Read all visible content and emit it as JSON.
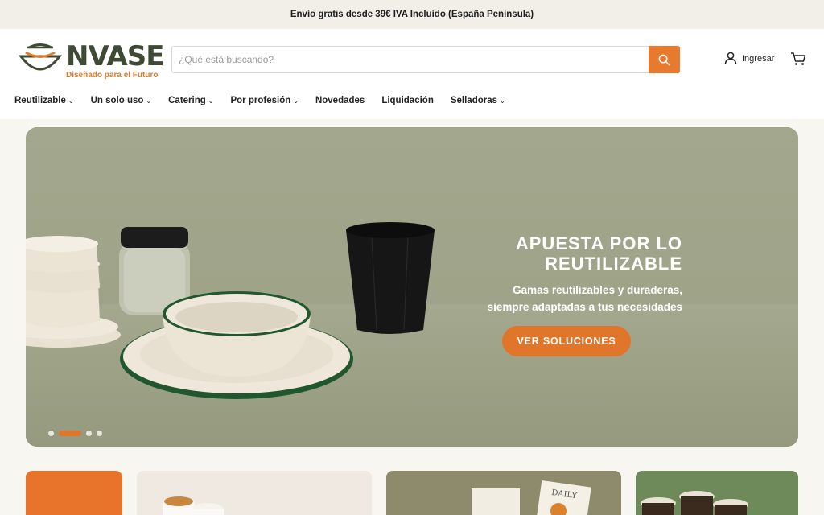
{
  "announcement": "Envío gratis desde 39€ IVA Incluído (España Península)",
  "brand": {
    "name": "NVASE",
    "tagline": "Diseñado para el Futuro",
    "primary_color": "#3f4a34",
    "accent_color": "#e67a2e"
  },
  "search": {
    "placeholder": "¿Qué está buscando?",
    "value": "",
    "icon": "search-icon"
  },
  "account": {
    "label": "Ingresar",
    "icon": "user-icon"
  },
  "cart": {
    "icon": "cart-icon"
  },
  "nav": {
    "items": [
      {
        "label": "Reutilizable",
        "dropdown": true
      },
      {
        "label": "Un solo uso",
        "dropdown": true
      },
      {
        "label": "Catering",
        "dropdown": true
      },
      {
        "label": "Por profesión",
        "dropdown": true
      },
      {
        "label": "Novedades",
        "dropdown": false
      },
      {
        "label": "Liquidación",
        "dropdown": false
      },
      {
        "label": "Selladoras",
        "dropdown": true
      }
    ]
  },
  "hero": {
    "title_line1": "APUESTA POR LO",
    "title_line2": "REUTILIZABLE",
    "subtitle_line1": "Gamas reutilizables y duraderas,",
    "subtitle_line2": "siempre adaptadas a tus necesidades",
    "cta": "VER SOLUCIONES",
    "slides": 4,
    "active_slide": 2
  }
}
